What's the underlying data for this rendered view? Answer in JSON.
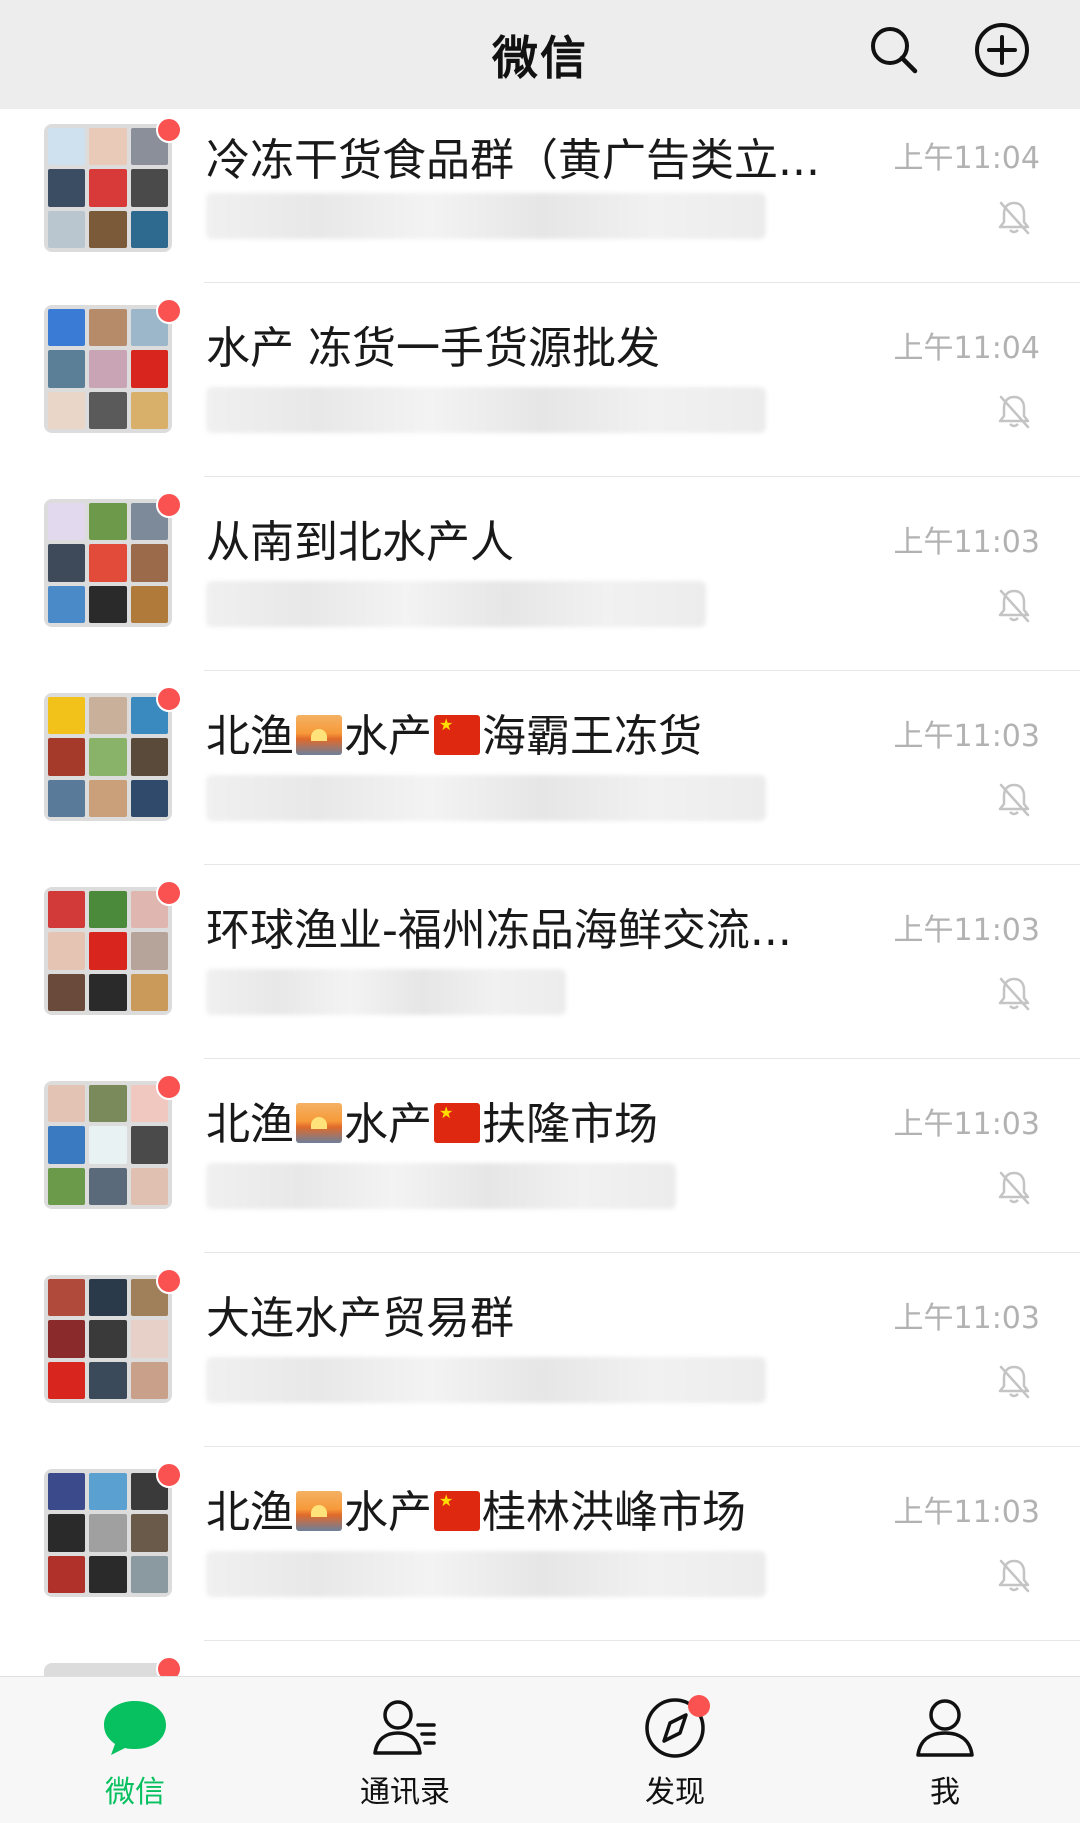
{
  "header": {
    "title": "微信",
    "search_icon": "search-icon",
    "add_icon": "plus-circle-icon"
  },
  "chats": [
    {
      "name": "冷冻干货食品群（黄广告类立...",
      "time": "上午11:04",
      "muted": true,
      "unread": true,
      "avatar_colors": [
        "#cfe0ee",
        "#e9c9b8",
        "#8a8f99",
        "#3b4d63",
        "#d83a3a",
        "#4a4a4a",
        "#b9c5cf",
        "#7b5a3a",
        "#2e6a8f"
      ]
    },
    {
      "name": "水产 冻货一手货源批发",
      "time": "上午11:04",
      "muted": true,
      "unread": true,
      "avatar_colors": [
        "#3a7bd5",
        "#b58b6a",
        "#9cb7c9",
        "#5b7f96",
        "#c8a4b5",
        "#d8261e",
        "#e9d6c8",
        "#5a5a5a",
        "#d9b06a"
      ]
    },
    {
      "name": "从南到北水产人",
      "time": "上午11:03",
      "muted": true,
      "unread": true,
      "avatar_colors": [
        "#e3d9ef",
        "#6c9a4a",
        "#7d8a99",
        "#3e4a5a",
        "#e24a3a",
        "#9a6a4a",
        "#4a8ac9",
        "#2a2a2a",
        "#b07a3a"
      ]
    },
    {
      "name_parts": [
        "北渔",
        "sunrise",
        "水产",
        "flag-cn",
        "海霸王冻货"
      ],
      "time": "上午11:03",
      "muted": true,
      "unread": true,
      "avatar_colors": [
        "#f2c21a",
        "#c9b09a",
        "#3a8ac0",
        "#a63a2a",
        "#8ab36a",
        "#5a4a3a",
        "#5a7a9a",
        "#c9a07a",
        "#2f4a6a"
      ]
    },
    {
      "name": "环球渔业-福州冻品海鲜交流...",
      "time": "上午11:03",
      "muted": true,
      "unread": true,
      "avatar_colors": [
        "#d23a3a",
        "#4a8a3a",
        "#e0b6b0",
        "#e6c4b4",
        "#d8261e",
        "#b6a49a",
        "#6a4a3a",
        "#2a2a2a",
        "#c99a5a"
      ]
    },
    {
      "name_parts": [
        "北渔",
        "sunrise",
        "水产",
        "flag-cn",
        "扶隆市场"
      ],
      "time": "上午11:03",
      "muted": true,
      "unread": true,
      "avatar_colors": [
        "#e3c4b4",
        "#7a8a5a",
        "#f0c8c0",
        "#3a7ac0",
        "#e8f2f2",
        "#4a4a4a",
        "#6a9a4a",
        "#5a6a7a",
        "#e0c0b0"
      ]
    },
    {
      "name": "大连水产贸易群",
      "time": "上午11:03",
      "muted": true,
      "unread": true,
      "avatar_colors": [
        "#b04a3a",
        "#2a3a4a",
        "#a0805a",
        "#8a2a2a",
        "#3a3a3a",
        "#e6d0c8",
        "#d8261e",
        "#3a4a5a",
        "#c9a08a"
      ]
    },
    {
      "name_parts": [
        "北渔",
        "sunrise",
        "水产",
        "flag-cn",
        "桂林洪峰市场"
      ],
      "time": "上午11:03",
      "muted": true,
      "unread": true,
      "avatar_colors": [
        "#3a4a8a",
        "#5aa0d0",
        "#3a3a3a",
        "#2a2a2a",
        "#a0a0a0",
        "#6a5a4a",
        "#b0302a",
        "#2a2a2a",
        "#8a9aa0"
      ]
    },
    {
      "name": "",
      "time": "",
      "muted": false,
      "unread": true,
      "avatar_colors": [
        "#dcdcdc",
        "#dcdcdc",
        "#dcdcdc",
        "#dcdcdc",
        "#dcdcdc",
        "#dcdcdc",
        "#dcdcdc",
        "#dcdcdc",
        "#dcdcdc"
      ]
    }
  ],
  "tabs": [
    {
      "label": "微信",
      "icon": "chat-bubble-icon",
      "active": true,
      "dot": false
    },
    {
      "label": "通讯录",
      "icon": "contacts-icon",
      "active": false,
      "dot": false
    },
    {
      "label": "发现",
      "icon": "compass-icon",
      "active": false,
      "dot": true
    },
    {
      "label": "我",
      "icon": "person-icon",
      "active": false,
      "dot": false
    }
  ],
  "colors": {
    "accent_green": "#07c160",
    "unread_red": "#fa5151",
    "time_gray": "#b2b2b2"
  }
}
